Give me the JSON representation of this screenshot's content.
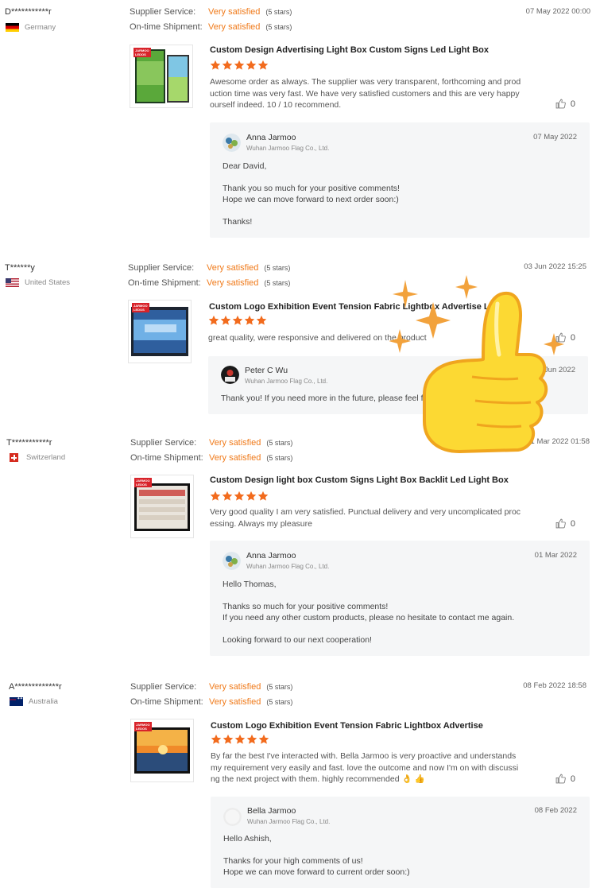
{
  "labels": {
    "supplier_service": "Supplier Service:",
    "ontime_shipment": "On-time Shipment:",
    "company": "Wuhan Jarmoo Flag Co., Ltd."
  },
  "colors": {
    "accent": "#f07a1a",
    "star": "#f26b1d"
  },
  "reviews": [
    {
      "buyer": "D***********r",
      "country": "Germany",
      "flag": "flag-de",
      "supplier_service": "Very satisfied",
      "supplier_service_stars": "(5 stars)",
      "shipment": "Very satisfied",
      "shipment_stars": "(5 stars)",
      "date": "07 May 2022 00:00",
      "product": "Custom Design Advertising Light Box Custom Signs Led Light Box",
      "rating": 5,
      "text": "Awesome order as always. The supplier was very transparent, forthcoming and production time was very fast. We have very satisfied customers and this are very happy ourself indeed. 10 / 10 recommend.",
      "likes": "0",
      "reply": {
        "name": "Anna Jarmoo",
        "date": "07 May 2022",
        "text": "Dear David,\n\nThank you so much for your positive comments!\nHope we can move forward to next  order soon:)\n\nThanks!"
      }
    },
    {
      "buyer": "T******y",
      "country": "United States",
      "flag": "flag-us",
      "supplier_service": "Very satisfied",
      "supplier_service_stars": "(5 stars)",
      "shipment": "Very satisfied",
      "shipment_stars": "(5 stars)",
      "date": "03 Jun 2022 15:25",
      "product": "Custom Logo Exhibition Event Tension Fabric Lightbox Advertise Le",
      "rating": 5,
      "text": "great quality, were responsive and delivered on the product",
      "likes": "0",
      "reply": {
        "name": "Peter C Wu",
        "date": "05 Jun 2022",
        "text": "Thank you! If you need more in the future, please feel fr"
      }
    },
    {
      "buyer": "T***********r",
      "country": "Switzerland",
      "flag": "flag-ch",
      "supplier_service": "Very satisfied",
      "supplier_service_stars": "(5 stars)",
      "shipment": "Very satisfied",
      "shipment_stars": "(5 stars)",
      "date": "01 Mar 2022 01:58",
      "product": "Custom Design light box Custom Signs Light Box Backlit Led Light Box",
      "rating": 5,
      "text": "Very good quality I am very satisfied. Punctual delivery and very uncomplicated processing. Always my pleasure",
      "likes": "0",
      "reply": {
        "name": "Anna Jarmoo",
        "date": "01 Mar 2022",
        "text": "Hello Thomas,\n\nThanks so much for your positive comments!\nIf you need any other custom products, please no hesitate to contact me again.\n\nLooking forward to our next cooperation!"
      }
    },
    {
      "buyer": "A*************r",
      "country": "Australia",
      "flag": "flag-au",
      "supplier_service": "Very satisfied",
      "supplier_service_stars": "(5 stars)",
      "shipment": "Very satisfied",
      "shipment_stars": "(5 stars)",
      "date": "08 Feb 2022 18:58",
      "product": "Custom Logo Exhibition Event Tension Fabric Lightbox Advertise",
      "rating": 5,
      "text": "By far the best I've interacted with. Bella Jarmoo is very proactive and understands my requirement very easily and fast. love the outcome and now I'm on with discussing the next project with them. highly recommended 👌 👍",
      "likes": "0",
      "reply": {
        "name": "Bella Jarmoo",
        "date": "08 Feb 2022",
        "text": "Hello Ashish,\n\nThanks for your high comments of us!\nHope we can move forward to current order soon:)"
      }
    }
  ]
}
